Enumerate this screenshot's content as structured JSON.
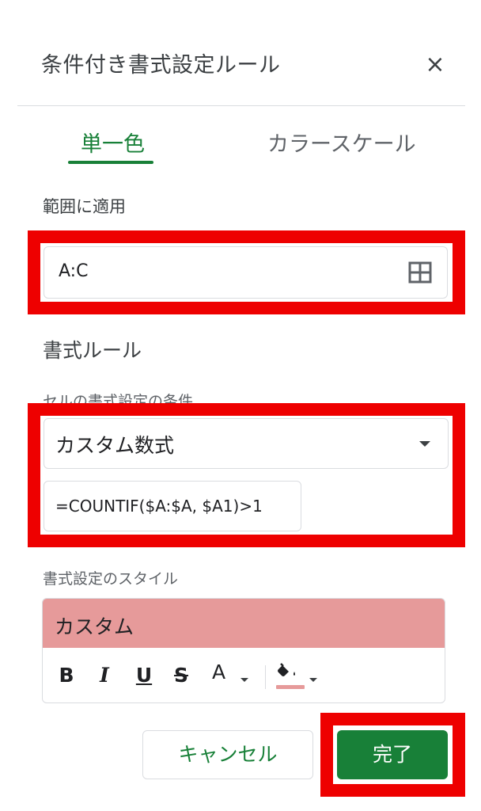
{
  "panel": {
    "title": "条件付き書式設定ルール",
    "close_glyph": "×"
  },
  "tabs": [
    {
      "label": "単一色",
      "active": true
    },
    {
      "label": "カラースケール",
      "active": false
    }
  ],
  "apply_range": {
    "label": "範囲に適用",
    "value": "A:C",
    "icon": "grid-select-icon"
  },
  "format_rules": {
    "heading": "書式ルール",
    "condition_label": "セルの書式設定の条件…",
    "condition_selected": "カスタム数式",
    "formula": "=COUNTIF($A:$A, $A1)>1"
  },
  "format_style": {
    "label": "書式設定のスタイル",
    "preview_text": "カスタム",
    "preview_color": "#e69a9a",
    "toolbar": {
      "bold": "B",
      "italic": "I",
      "underline": "U",
      "strike": "S",
      "text_color": "A"
    },
    "fill_color_indicator": "#e69a9a"
  },
  "buttons": {
    "cancel": "キャンセル",
    "done": "完了"
  },
  "colors": {
    "accent": "#188038",
    "annotation": "#ee0000"
  }
}
